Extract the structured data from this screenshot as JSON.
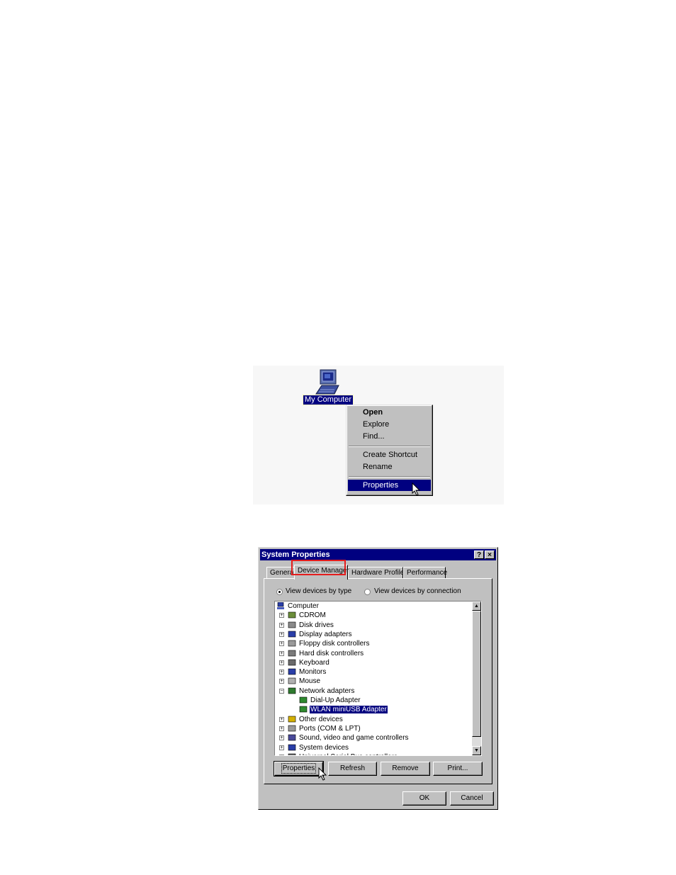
{
  "desktop": {
    "icon_name": "computer-icon",
    "icon_label": "My Computer"
  },
  "context_menu": {
    "items": [
      {
        "label": "Open"
      },
      {
        "label": "Explore"
      },
      {
        "label": "Find..."
      },
      {
        "label": "Create Shortcut"
      },
      {
        "label": "Rename"
      },
      {
        "label": "Properties"
      }
    ],
    "selected": "Properties"
  },
  "dialog": {
    "title": "System Properties",
    "help_button": "?",
    "close_button": "×",
    "tabs": [
      {
        "label": "General"
      },
      {
        "label": "Device Manager"
      },
      {
        "label": "Hardware Profiles"
      },
      {
        "label": "Performance"
      }
    ],
    "active_tab": "Device Manager",
    "highlight_color": "#e41d1d",
    "view_options": [
      {
        "label": "View devices by type",
        "checked": true
      },
      {
        "label": "View devices by connection",
        "checked": false
      }
    ],
    "tree": [
      {
        "label": "Computer",
        "icon": "computer-icon"
      },
      {
        "label": "CDROM",
        "icon": "cdrom-icon"
      },
      {
        "label": "Disk drives",
        "icon": "disk-drive-icon"
      },
      {
        "label": "Display adapters",
        "icon": "display-adapter-icon"
      },
      {
        "label": "Floppy disk controllers",
        "icon": "floppy-controller-icon"
      },
      {
        "label": "Hard disk controllers",
        "icon": "hard-disk-controller-icon"
      },
      {
        "label": "Keyboard",
        "icon": "keyboard-icon"
      },
      {
        "label": "Monitors",
        "icon": "monitor-icon"
      },
      {
        "label": "Mouse",
        "icon": "mouse-icon"
      },
      {
        "label": "Network adapters",
        "icon": "network-adapter-icon"
      },
      {
        "label": "Dial-Up Adapter",
        "icon": "network-card-icon"
      },
      {
        "label": "WLAN miniUSB Adapter",
        "icon": "network-card-icon"
      },
      {
        "label": "Other devices",
        "icon": "question-icon"
      },
      {
        "label": "Ports (COM & LPT)",
        "icon": "port-icon"
      },
      {
        "label": "Sound, video and game controllers",
        "icon": "sound-icon"
      },
      {
        "label": "System devices",
        "icon": "system-device-icon"
      },
      {
        "label": "Universal Serial Bus controllers",
        "icon": "usb-icon"
      }
    ],
    "selected_device": "WLAN miniUSB Adapter",
    "buttons": {
      "properties": "Properties",
      "refresh": "Refresh",
      "remove": "Remove",
      "print": "Print...",
      "ok": "OK",
      "cancel": "Cancel"
    }
  },
  "colors": {
    "selection": "#000080",
    "face": "#c0c0c0"
  }
}
